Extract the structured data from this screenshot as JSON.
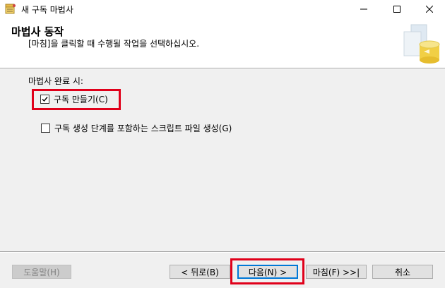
{
  "window": {
    "title": "새 구독 마법사",
    "icons": [
      "wizard-app-icon",
      "minimize-icon",
      "maximize-icon",
      "close-icon"
    ]
  },
  "header": {
    "title": "마법사 동작",
    "subtitle": "[마침]을 클릭할 때 수행될 작업을 선택하십시오.",
    "art_icon": "database-wizard-icon"
  },
  "content": {
    "group_label": "마법사 완료 시:",
    "options": [
      {
        "label": "구독 만들기(C)",
        "checked": true
      },
      {
        "label": "구독 생성 단계를 포함하는 스크립트 파일 생성(G)",
        "checked": false
      }
    ]
  },
  "buttons": {
    "help": "도움말(H)",
    "back": "< 뒤로(B)",
    "next": "다음(N) >",
    "finish": "마침(F) >>|",
    "cancel": "취소"
  },
  "colors": {
    "highlight": "#e0001a",
    "focus": "#0078d7",
    "content_bg": "#f0f0f0"
  }
}
